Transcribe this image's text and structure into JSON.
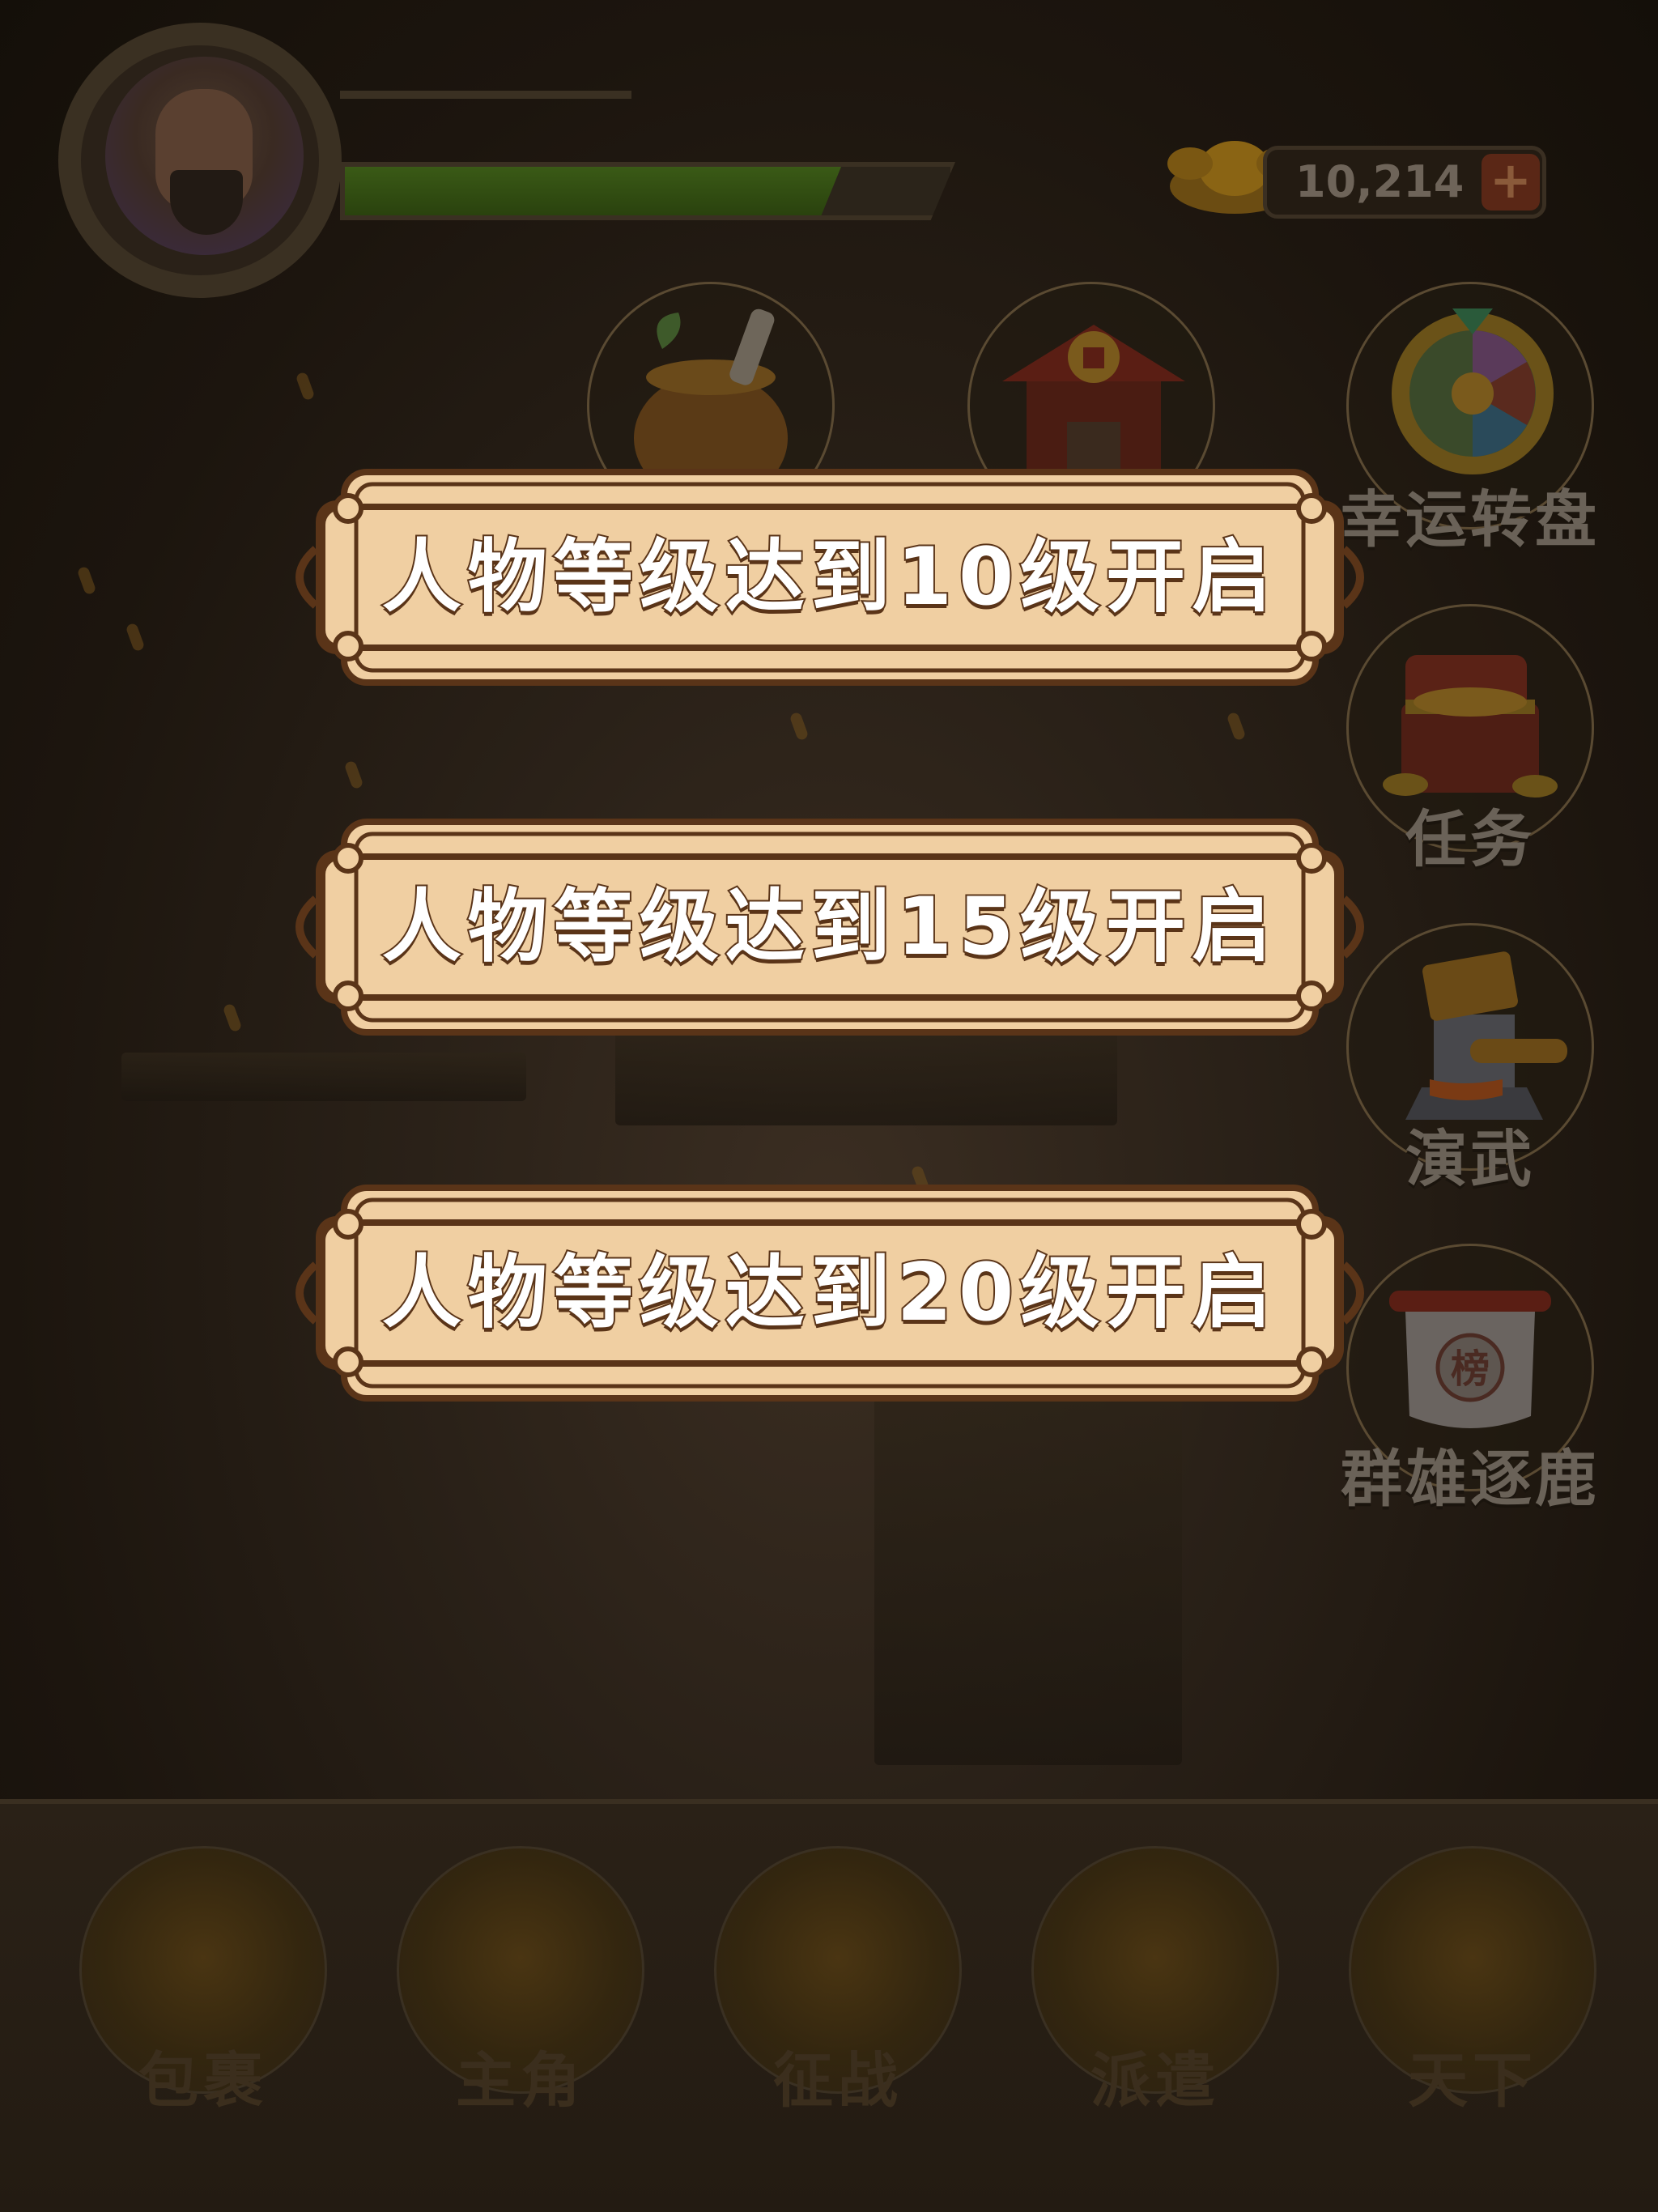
{
  "hud": {
    "currency_value": "10,214",
    "plus_label": "+",
    "exp_progress": 0.82
  },
  "features": {
    "lucky_wheel_label": "幸运转盘",
    "task_label": "任务",
    "training_label": "演武",
    "ranking_label": "群雄逐鹿",
    "ranking_glyph": "榜"
  },
  "lock_banners": [
    {
      "text": "人物等级达到10级开启"
    },
    {
      "text": "人物等级达到15级开启"
    },
    {
      "text": "人物等级达到20级开启"
    }
  ],
  "bottom_nav": [
    {
      "label": "包裹"
    },
    {
      "label": "主角"
    },
    {
      "label": "征战"
    },
    {
      "label": "派遣"
    },
    {
      "label": "天下"
    }
  ],
  "colors": {
    "banner_fill": "#f0cfa2",
    "banner_border": "#5a3418",
    "overlay_dark": "#1a140d",
    "exp_green": "#3a5a16"
  }
}
